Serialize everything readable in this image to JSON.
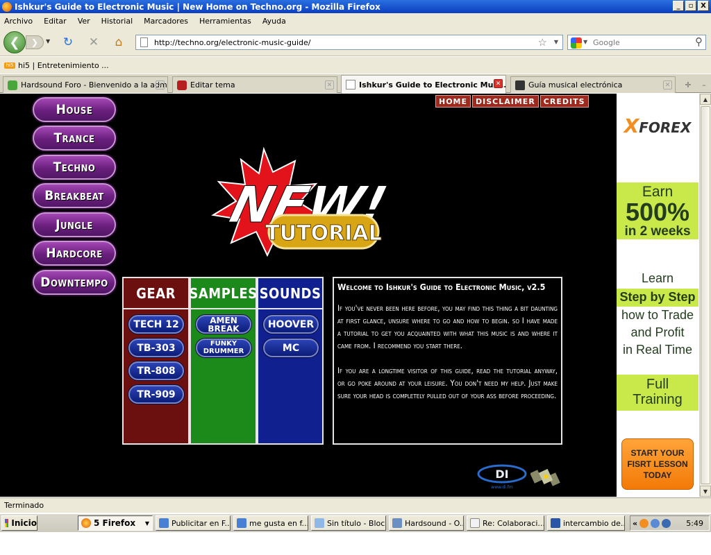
{
  "window": {
    "title": "Ishkur's Guide to Electronic Music | New Home on Techno.org - Mozilla Firefox",
    "buttons": [
      "_",
      "▫",
      "X"
    ]
  },
  "menubar": {
    "items": [
      "Archivo",
      "Editar",
      "Ver",
      "Historial",
      "Marcadores",
      "Herramientas",
      "Ayuda"
    ]
  },
  "navbar": {
    "url": "http://techno.org/electronic-music-guide/",
    "search_placeholder": "Google"
  },
  "bookmarks": {
    "items": [
      {
        "label": "hi5 | Entretenimiento ...",
        "icon_text": "hi5"
      }
    ]
  },
  "tabs": [
    {
      "label": "Hardsound Foro - Bienvenido a la adm...",
      "icon": "speech-bubble-icon",
      "color": "#4aa63a"
    },
    {
      "label": "Editar tema",
      "icon": "forum-icon",
      "color": "#b51f1f"
    },
    {
      "label": "Ishkur's Guide to Electronic Mus...",
      "icon": "page-icon",
      "color": "#ffffff"
    },
    {
      "label": "Guía musical electrónica",
      "icon": "ame-icon",
      "color": "#333333"
    }
  ],
  "page": {
    "genres": [
      "House",
      "Trance",
      "Techno",
      "Breakbeat",
      "Jungle",
      "Hardcore",
      "Downtempo"
    ],
    "topnav": [
      "HOME",
      "DISCLAIMER",
      "CREDITS"
    ],
    "logo": {
      "new_text": "NEW!",
      "tutorial_text": "TUTORIAL"
    },
    "columns": [
      {
        "header": "GEAR",
        "color": "#6b0f0f",
        "items": [
          "TECH 12",
          "TB-303",
          "TR-808",
          "TR-909"
        ]
      },
      {
        "header": "SAMPLES",
        "color": "#1b8a1b",
        "items": [
          "AMEN BREAK",
          "FUNKY DRUMMER"
        ]
      },
      {
        "header": "SOUNDS",
        "color": "#10208f",
        "items": [
          "HOOVER",
          "MC"
        ]
      }
    ],
    "welcome": {
      "title": "Welcome to Ishkur's Guide to Electronic Music, v2.5",
      "paragraphs": [
        "If you've never been here before, you may find this thing a bit daunting at first glance, unsure where to go and how to begin. so I have made a tutorial to get you acquainted with what this music is and where it came from. I recommend you start there.",
        "If you are a longtime visitor of this guide, read the tutorial anyway, or go poke around at your leisure. You don't need my help. Just make sure your head is completely pulled out of your ass before proceeding."
      ]
    },
    "di_logo": {
      "letters": "DI",
      "caption": "www.di.fm"
    }
  },
  "ad": {
    "brand": "FOREX",
    "brand_x": "X",
    "earn": "Earn",
    "percent": "500%",
    "period": "in 2 weeks",
    "learn": "Learn",
    "step": "Step by Step",
    "how": "how to Trade",
    "and_profit": "and Profit",
    "real_time": "in Real Time",
    "full": "Full",
    "training": "Training",
    "cta": "START YOUR FISRT LESSON TODAY",
    "accent": "#c9e84a"
  },
  "status": {
    "text": "Terminado"
  },
  "taskbar": {
    "start": "Inicio",
    "tasks": [
      {
        "label": "5 Firefox",
        "active": true
      },
      {
        "label": "Publicitar en F...",
        "active": false
      },
      {
        "label": "me gusta en f...",
        "active": false
      },
      {
        "label": "Sin título - Bloc...",
        "active": false
      },
      {
        "label": "Hardsound - O...",
        "active": false
      },
      {
        "label": "Re: Colaboraci...",
        "active": false
      },
      {
        "label": "intercambio de...",
        "active": false
      }
    ],
    "clock": "5:49",
    "tray_arrow": "«"
  }
}
